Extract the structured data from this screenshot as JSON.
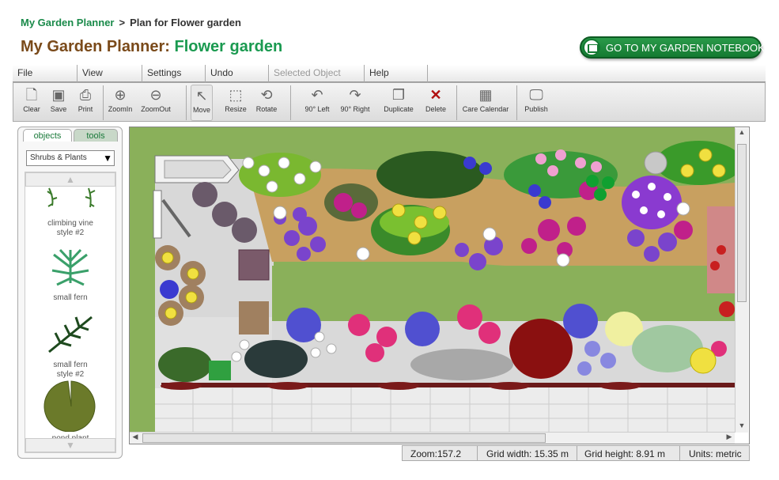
{
  "breadcrumb": {
    "home": "My Garden Planner",
    "separator": ">",
    "current": "Plan for Flower garden"
  },
  "title": {
    "prefix": "My Garden Planner:",
    "name": "Flower garden"
  },
  "notebook_button": {
    "label": "GO TO MY GARDEN NOTEBOOK",
    "icon": "notebook-icon"
  },
  "menu": [
    {
      "label": "File",
      "enabled": true
    },
    {
      "label": "View",
      "enabled": true
    },
    {
      "label": "Settings",
      "enabled": true
    },
    {
      "label": "Undo",
      "enabled": true
    },
    {
      "label": "Selected Object",
      "enabled": false
    },
    {
      "label": "Help",
      "enabled": true
    }
  ],
  "toolbar": [
    {
      "label": "Clear",
      "icon": "page-icon"
    },
    {
      "label": "Save",
      "icon": "floppy-icon"
    },
    {
      "label": "Print",
      "icon": "printer-icon"
    },
    {
      "label": "ZoomIn",
      "icon": "zoom-in-icon"
    },
    {
      "label": "ZoomOut",
      "icon": "zoom-out-icon"
    },
    {
      "label": "Move",
      "icon": "cursor-icon"
    },
    {
      "label": "Resize",
      "icon": "resize-icon"
    },
    {
      "label": "Rotate",
      "icon": "rotate-icon"
    },
    {
      "label": "90° Left",
      "icon": "rotate-left-icon"
    },
    {
      "label": "90° Right",
      "icon": "rotate-right-icon"
    },
    {
      "label": "Duplicate",
      "icon": "duplicate-icon"
    },
    {
      "label": "Delete",
      "icon": "delete-icon"
    },
    {
      "label": "Care Calendar",
      "icon": "calendar-icon"
    },
    {
      "label": "Publish",
      "icon": "monitor-icon"
    }
  ],
  "left_panel": {
    "tabs": [
      "objects",
      "tools"
    ],
    "active_tab": "objects",
    "category": "Shrubs & Plants",
    "palette": [
      {
        "label": "climbing vine style #2",
        "line1": "climbing vine",
        "line2": "style #2",
        "icon": "climbing-vine-icon"
      },
      {
        "label": "small fern",
        "line1": "small fern",
        "line2": "",
        "icon": "small-fern-icon"
      },
      {
        "label": "small fern style #2",
        "line1": "small fern",
        "line2": "style #2",
        "icon": "small-fern-2-icon"
      },
      {
        "label": "pond plant",
        "line1": "pond plant",
        "line2": "",
        "icon": "pond-plant-icon"
      }
    ]
  },
  "status": {
    "zoom": "Zoom:157.2",
    "grid_width": "Grid width: 15.35 m",
    "grid_height": "Grid height: 8.91 m",
    "units": "Units: metric"
  },
  "colors": {
    "brand_green": "#1a9a50",
    "title_brown": "#7a4a1a",
    "lawn": "#8ab05a",
    "bed_soil": "#c8a060"
  }
}
